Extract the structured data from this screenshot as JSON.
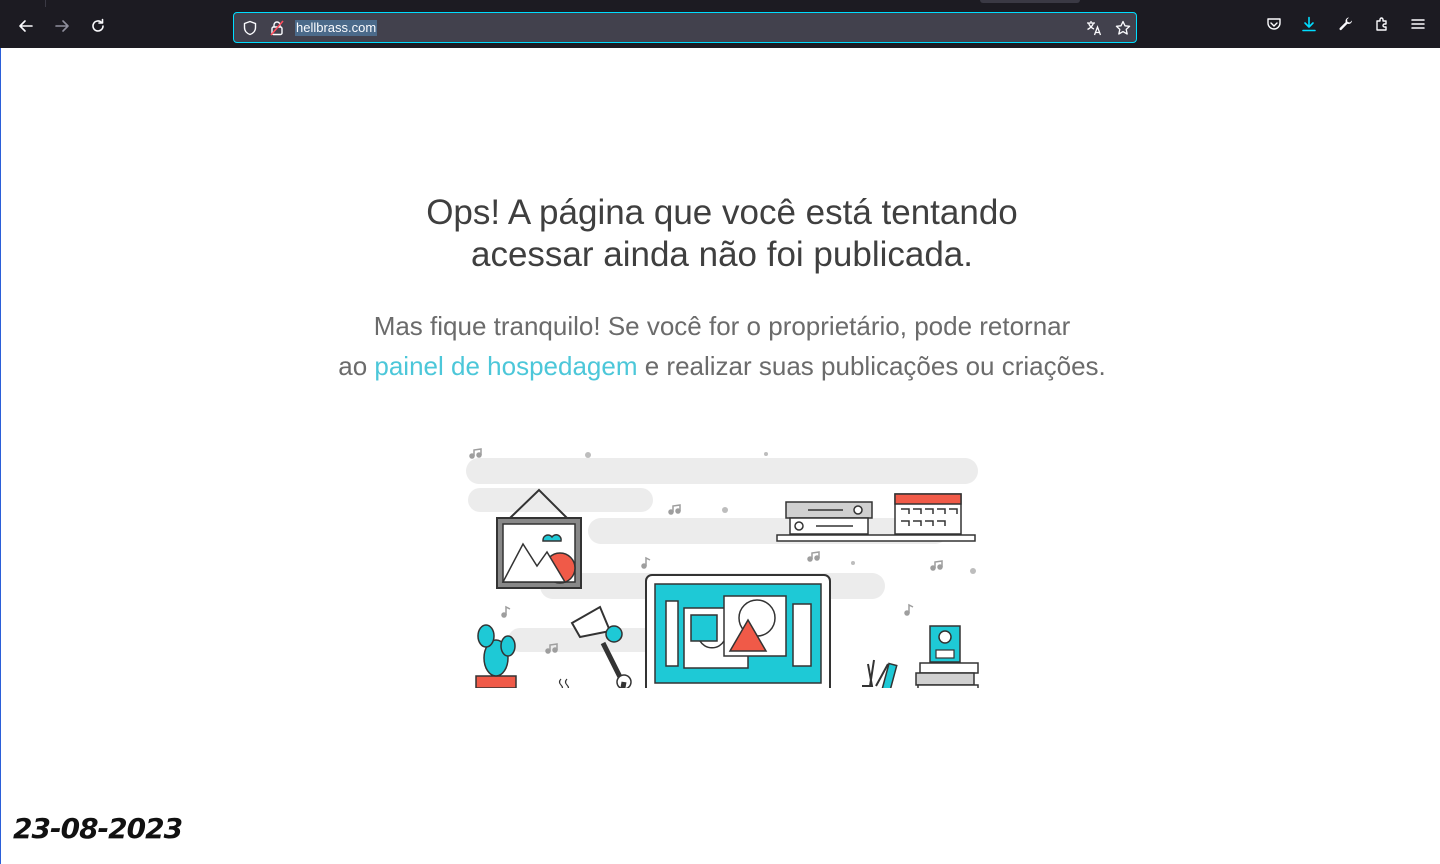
{
  "browser": {
    "url": "hellbrass.com",
    "icons": {
      "back": "back-arrow-icon",
      "forward": "forward-arrow-icon",
      "reload": "reload-icon",
      "tracking": "shield-icon",
      "lock": "lock-icon",
      "translate": "translate-icon",
      "bookmark": "star-icon",
      "pocket": "pocket-icon",
      "downloads": "download-icon",
      "tools": "wrench-icon",
      "extensions": "puzzle-icon",
      "menu": "hamburger-menu-icon"
    },
    "accent_color": "#00ddff"
  },
  "page": {
    "title_line1": "Ops! A página que você está tentando",
    "title_line2": "acessar ainda não foi publicada.",
    "sub_line1": "Mas fique tranquilo! Se você for o proprietário, pode retornar",
    "sub_prefix": "ao",
    "sub_link": "painel de hospedagem",
    "sub_suffix": "e realizar suas publicações ou criações.",
    "link_color": "#4cc7d9",
    "illustration": "workspace-desk-illustration"
  },
  "overlay": {
    "date_stamp": "23-08-2023"
  }
}
